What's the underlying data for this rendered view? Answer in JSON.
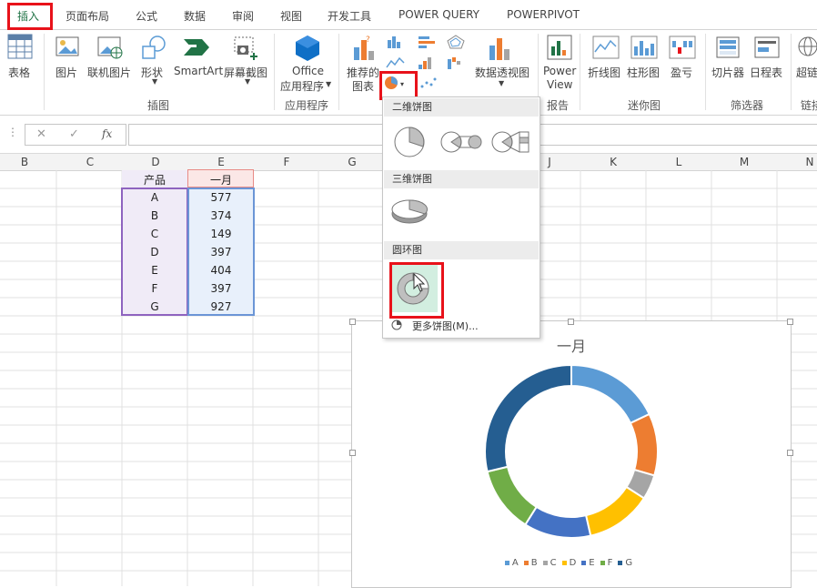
{
  "tabs": [
    {
      "label": "插入",
      "active": true
    },
    {
      "label": "页面布局"
    },
    {
      "label": "公式"
    },
    {
      "label": "数据"
    },
    {
      "label": "审阅"
    },
    {
      "label": "视图"
    },
    {
      "label": "开发工具"
    },
    {
      "label": "POWER QUERY"
    },
    {
      "label": "POWERPIVOT"
    }
  ],
  "ribbon": {
    "table": "表格",
    "picture": "图片",
    "online_picture": "联机图片",
    "shapes": "形状",
    "smartart": "SmartArt",
    "screenshot": "屏幕截图",
    "office_line1": "Office",
    "office_line2": "应用程序",
    "recommended_line1": "推荐的",
    "recommended_line2": "图表",
    "pivot_chart": "数据透视图",
    "power_view_line1": "Power",
    "power_view_line2": "View",
    "line": "折线图",
    "column": "柱形图",
    "winloss": "盈亏",
    "slicer": "切片器",
    "timeline": "日程表",
    "link": "超链",
    "groups": {
      "illustrations": "插图",
      "apps": "应用程序",
      "reports": "报告",
      "sparklines": "迷你图",
      "filters": "筛选器",
      "links": "链接"
    }
  },
  "formula_bar": {
    "cancel": "✕",
    "enter": "✓",
    "fx": "fx",
    "value": ""
  },
  "columns": [
    "B",
    "C",
    "D",
    "E",
    "F",
    "G",
    "J",
    "K",
    "L",
    "M",
    "N"
  ],
  "table": {
    "header_product": "产品",
    "header_month": "一月",
    "rows": [
      {
        "product": "A",
        "value": "577"
      },
      {
        "product": "B",
        "value": "374"
      },
      {
        "product": "C",
        "value": "149"
      },
      {
        "product": "D",
        "value": "397"
      },
      {
        "product": "E",
        "value": "404"
      },
      {
        "product": "F",
        "value": "397"
      },
      {
        "product": "G",
        "value": "927"
      }
    ]
  },
  "dropdown": {
    "section_2d": "二维饼图",
    "section_3d": "三维饼图",
    "section_donut": "圆环图",
    "more": "更多饼图(M)..."
  },
  "colors": {
    "accent_green": "#217346",
    "highlight_red": "#e8121a",
    "slice_A": "#5b9bd5",
    "slice_B": "#ed7d31",
    "slice_C": "#a5a5a5",
    "slice_D": "#ffc000",
    "slice_E": "#4472c4",
    "slice_F": "#70ad47",
    "slice_G": "#255e91"
  },
  "chart_data": {
    "type": "pie",
    "variant": "doughnut",
    "title": "一月",
    "categories": [
      "A",
      "B",
      "C",
      "D",
      "E",
      "F",
      "G"
    ],
    "values": [
      577,
      374,
      149,
      397,
      404,
      397,
      927
    ],
    "legend_position": "bottom"
  }
}
